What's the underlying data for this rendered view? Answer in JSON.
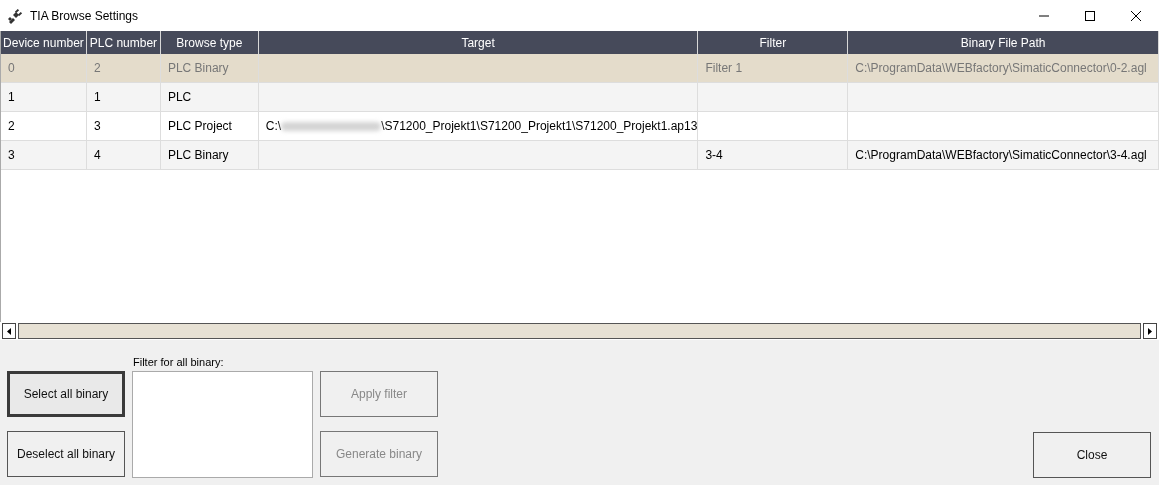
{
  "window": {
    "title": "TIA Browse Settings"
  },
  "table": {
    "columns": [
      "Device number",
      "PLC number",
      "Browse type",
      "Target",
      "Filter",
      "Binary File Path"
    ],
    "rows": [
      {
        "selected": true,
        "device_number": "0",
        "plc_number": "2",
        "browse_type": "PLC Binary",
        "target": null,
        "filter": "Filter 1",
        "binary_file_path": "C:\\ProgramData\\WEBfactory\\SimaticConnector\\0-2.agl"
      },
      {
        "selected": false,
        "device_number": "1",
        "plc_number": "1",
        "browse_type": "PLC",
        "target": null,
        "filter": "",
        "binary_file_path": ""
      },
      {
        "selected": false,
        "device_number": "2",
        "plc_number": "3",
        "browse_type": "PLC Project",
        "target": {
          "start": "C:\\",
          "redacted": true,
          "end": "\\S71200_Projekt1\\S71200_Projekt1\\S71200_Projekt1.ap13"
        },
        "filter": "",
        "binary_file_path": ""
      },
      {
        "selected": false,
        "device_number": "3",
        "plc_number": "4",
        "browse_type": "PLC Binary",
        "target": null,
        "filter": "3-4",
        "binary_file_path": "C:\\ProgramData\\WEBfactory\\SimaticConnector\\3-4.agl"
      }
    ]
  },
  "buttons_left": [
    {
      "label": "Select all binary",
      "focused": true,
      "disabled": false
    },
    {
      "label": "Deselect all binary",
      "focused": false,
      "disabled": false
    }
  ],
  "filter_field": {
    "label": "Filter for all binary:"
  },
  "buttons_middle": [
    {
      "label": "Apply filter",
      "focused": false,
      "disabled": true
    },
    {
      "label": "Generate binary",
      "focused": false,
      "disabled": true
    }
  ],
  "close_button": {
    "label": "Close",
    "focused": false,
    "disabled": false
  }
}
